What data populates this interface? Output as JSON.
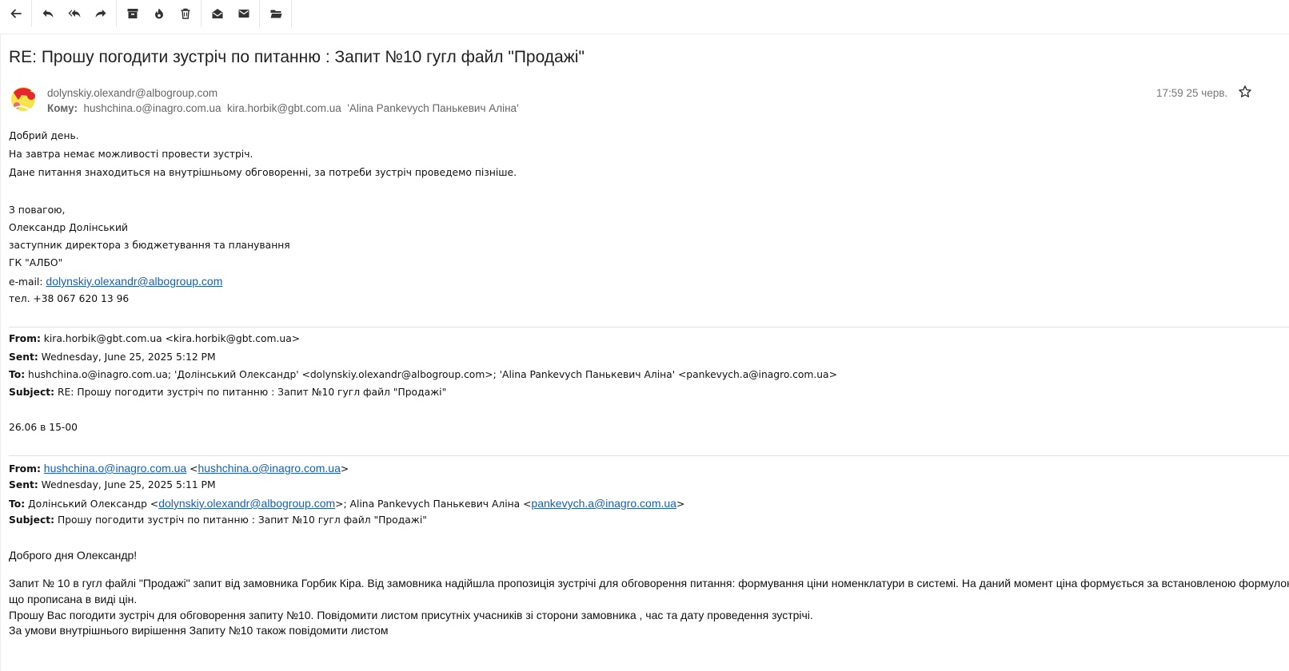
{
  "toolbar": {
    "icons": [
      "back-arrow-icon",
      "reply-icon",
      "reply-all-icon",
      "forward-icon",
      "archive-icon",
      "snooze-icon",
      "trash-icon",
      "mark-read-icon",
      "mark-unread-icon",
      "move-folder-icon"
    ]
  },
  "message": {
    "subject": "RE: Прошу погодити зустріч по питанню : Запит №10 гугл файл \"Продажі\"",
    "from": "dolynskiy.olexandr@albogroup.com",
    "to_label": "Кому:",
    "to_1": "hushchina.o@inagro.com.ua",
    "to_2": "kira.horbik@gbt.com.ua",
    "to_3": "'Alina Pankevych Панькевич Аліна'",
    "date": "17:59 25 черв."
  },
  "body": {
    "line1": "Добрий день.",
    "line2": "На завтра немає можливості провести зустріч.",
    "line3": "Дане питання знаходиться на внутрішньому обговоренні, за потреби зустріч проведемо пізніше.",
    "sig1": "З повагою,",
    "sig2": "Олександр Долінський",
    "sig3": "заступник директора з бюджетування та планування",
    "sig4": "ГК \"АЛБО\"",
    "sig_email_label": "e-mail: ",
    "sig_email": "dolynskiy.olexandr@albogroup.com",
    "sig_phone": "тел. +38 067 620 13 96"
  },
  "quote1": {
    "from_label": "From:",
    "from": " kira.horbik@gbt.com.ua <kira.horbik@gbt.com.ua>",
    "sent_label": "Sent:",
    "sent": " Wednesday, June 25, 2025 5:12 PM",
    "to_label": "To:",
    "to": " hushchina.o@inagro.com.ua; 'Долінський Олександр' <dolynskiy.olexandr@albogroup.com>; 'Alina Pankevych Панькевич Аліна' <pankevych.a@inagro.com.ua>",
    "subject_label": "Subject:",
    "subject": " RE: Прошу погодити зустріч по питанню : Запит №10 гугл файл \"Продажі\"",
    "text": "26.06 в 15-00"
  },
  "quote2": {
    "from_label": "From:",
    "from_link": "hushchina.o@inagro.com.ua",
    "from_lt": " <",
    "from_link2": "hushchina.o@inagro.com.ua",
    "from_gt": ">",
    "sent_label": "Sent:",
    "sent": " Wednesday, June 25, 2025 5:11 PM",
    "to_label": "To:",
    "to_a": " Долінський Олександр <",
    "to_link1": "dolynskiy.olexandr@albogroup.com",
    "to_b": ">; Alina Pankevych Панькевич Аліна <",
    "to_link2": "pankevych.a@inagro.com.ua",
    "to_c": ">",
    "subject_label": "Subject:",
    "subject": " Прошу погодити зустріч по питанню : Запит №10 гугл файл \"Продажі\"",
    "greeting": "Доброго дня Олександр!",
    "p1": "Запит № 10 в гугл файлі \"Продажі\" запит від замовника Горбик Кіра. Від замовника надійшла пропозиція зустрічі для обговорення питання: формування ціни номенклатури в системі. На даний момент ціна формується за встановленою формулою",
    "p2": "що прописана в виді цін.",
    "p3": "Прошу Вас погодити зустріч для обговорення запиту №10. Повідомити листом присутніх учасників зі сторони замовника ,  час та  дату проведення зустрічі.",
    "p4": "За умови внутрішнього вирішення Запиту №10 також повідомити листом"
  }
}
